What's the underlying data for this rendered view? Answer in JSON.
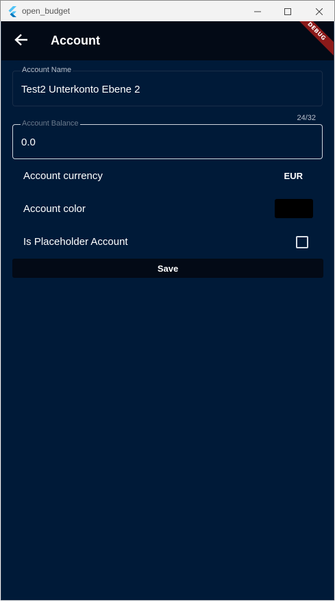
{
  "window": {
    "title": "open_budget",
    "icons": {
      "logo": "flutter-logo-icon",
      "minimize": "minimize-icon",
      "maximize": "maximize-icon",
      "close": "close-icon"
    }
  },
  "appbar": {
    "title": "Account",
    "back_icon": "arrow-left-icon",
    "debug_banner": "DEBUG"
  },
  "form": {
    "account_name": {
      "label": "Account Name",
      "value": "Test2 Unterkonto Ebene 2",
      "counter": "24/32"
    },
    "account_balance": {
      "label": "Account Balance",
      "value": "0.0"
    },
    "currency": {
      "label": "Account currency",
      "value": "EUR"
    },
    "color": {
      "label": "Account color",
      "value": "#000000"
    },
    "placeholder": {
      "label": "Is Placeholder Account",
      "checked": false
    },
    "save_label": "Save"
  },
  "colors": {
    "background": "#001a38",
    "appbar": "#030a16",
    "text": "#ffffff",
    "debug_ribbon": "#8b1a1a"
  }
}
